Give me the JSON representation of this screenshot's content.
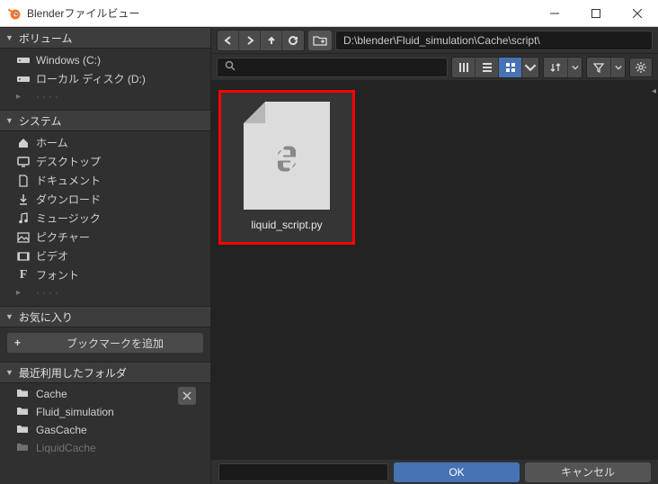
{
  "window": {
    "title": "Blenderファイルビュー"
  },
  "sidebar": {
    "volumes": {
      "header": "ボリューム",
      "items": [
        {
          "label": "Windows (C:)",
          "icon": "drive"
        },
        {
          "label": "ローカル ディスク (D:)",
          "icon": "drive"
        }
      ]
    },
    "system": {
      "header": "システム",
      "items": [
        {
          "label": "ホーム",
          "icon": "home"
        },
        {
          "label": "デスクトップ",
          "icon": "desktop"
        },
        {
          "label": "ドキュメント",
          "icon": "document"
        },
        {
          "label": "ダウンロード",
          "icon": "download"
        },
        {
          "label": "ミュージック",
          "icon": "music"
        },
        {
          "label": "ピクチャー",
          "icon": "picture"
        },
        {
          "label": "ビデオ",
          "icon": "video"
        },
        {
          "label": "フォント",
          "icon": "font"
        }
      ]
    },
    "favorites": {
      "header": "お気に入り",
      "add_label": "ブックマークを追加"
    },
    "recent": {
      "header": "最近利用したフォルダ",
      "items": [
        {
          "label": "Cache"
        },
        {
          "label": "Fluid_simulation"
        },
        {
          "label": "GasCache"
        },
        {
          "label": "LiquidCache"
        }
      ]
    }
  },
  "path": "D:\\blender\\Fluid_simulation\\Cache\\script\\",
  "files": [
    {
      "name": "liquid_script.py",
      "type": "python"
    }
  ],
  "footer": {
    "ok": "OK",
    "cancel": "キャンセル"
  }
}
